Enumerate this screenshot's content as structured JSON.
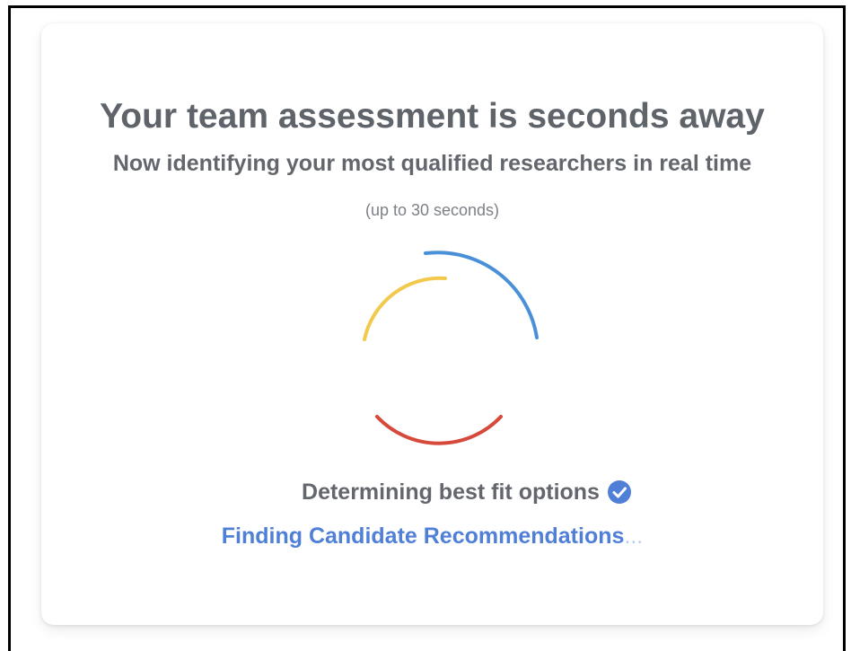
{
  "card": {
    "title": "Your team assessment is seconds away",
    "subtitle": "Now identifying your most qualified researchers in real time",
    "hint": "(up to 30 seconds)"
  },
  "spinner": {
    "colors": {
      "blue": "#4a90d9",
      "yellow": "#f2c94c",
      "red": "#d64a3b"
    }
  },
  "steps": {
    "done": {
      "label": "Determining best fit options",
      "icon": "check-circle-icon",
      "icon_color": "#4f7fd6"
    },
    "active": {
      "label": "Finding Candidate Recommendations",
      "ellipsis": "..."
    }
  }
}
